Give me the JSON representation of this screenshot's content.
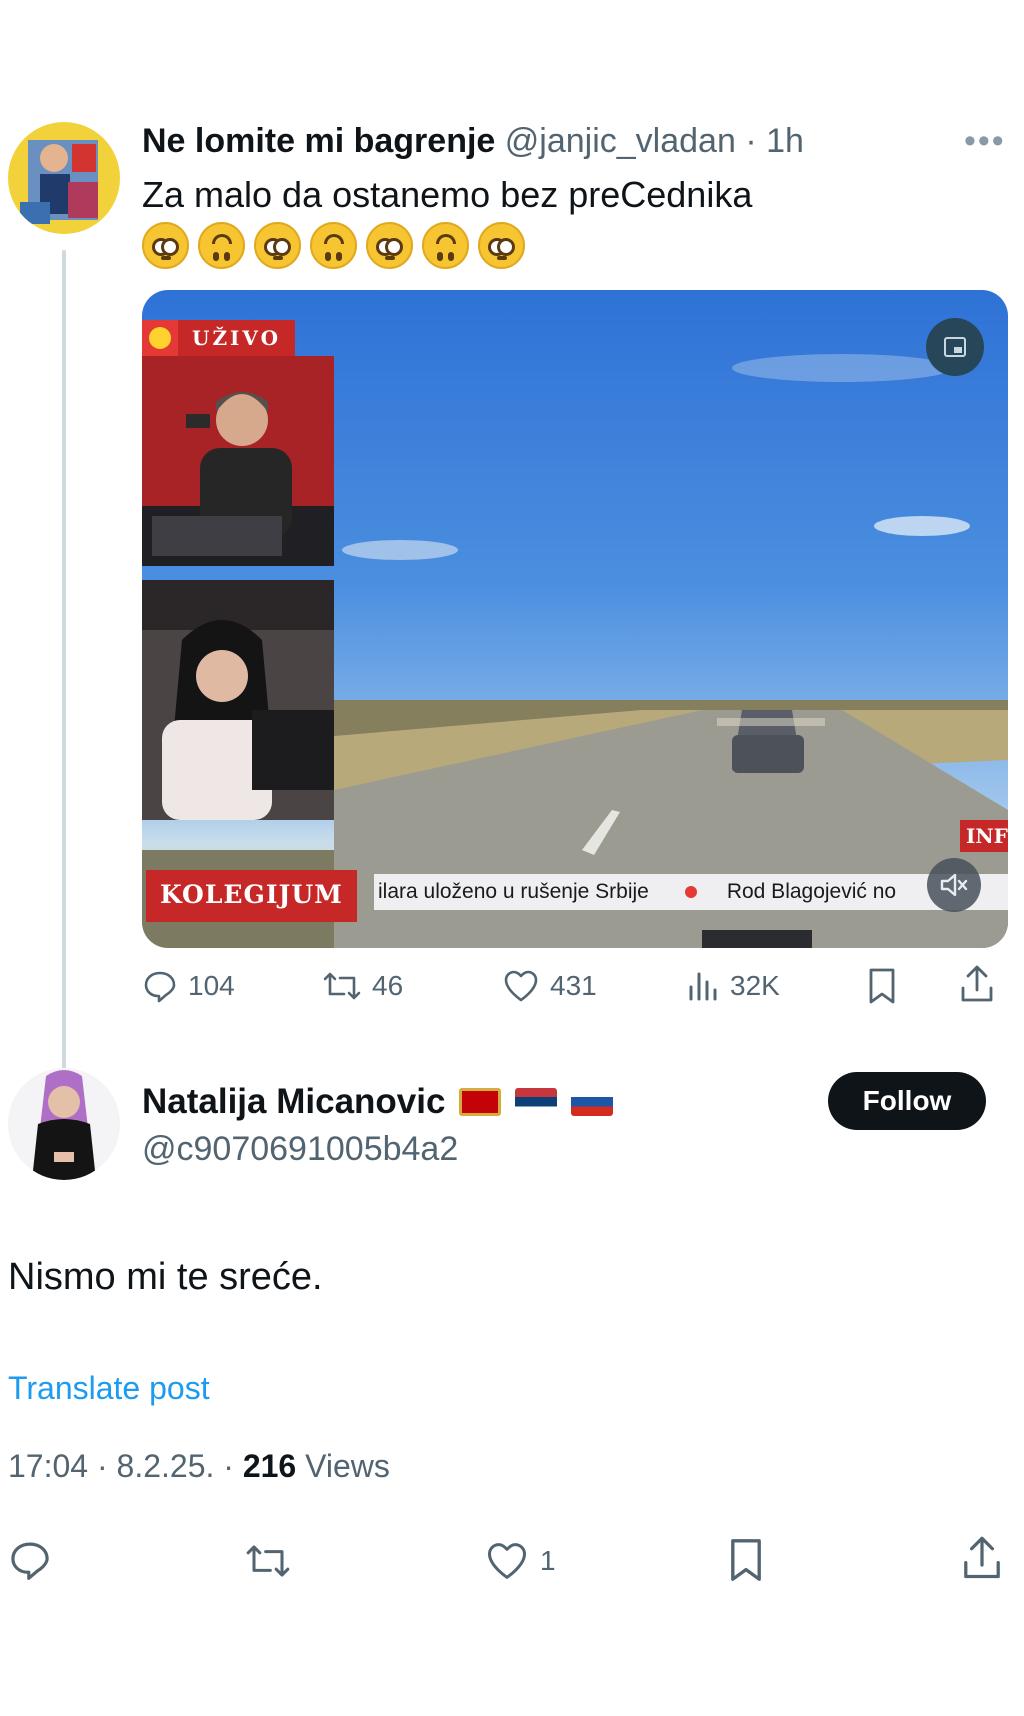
{
  "quoted_tweet": {
    "author_name": "Ne lomite mi bagrenje",
    "author_handle": "@janjic_vladan",
    "time_ago": "· 1h",
    "text": "Za malo da ostanemo bez preCednika",
    "emojis": [
      "flushed-face",
      "upside-down-face",
      "flushed-face",
      "upside-down-face",
      "flushed-face",
      "upside-down-face",
      "flushed-face"
    ],
    "video": {
      "live_label": "UŽIVO",
      "show_label": "KOLEGIJUM",
      "ticker_left": "ilara uloženo u rušenje Srbije",
      "ticker_right": "Rod Blagojević no",
      "channel_badge": "INF"
    },
    "stats": {
      "replies": "104",
      "reposts": "46",
      "likes": "431",
      "views": "32K"
    }
  },
  "reply_tweet": {
    "author_name": "Natalija Micanovic",
    "author_flags": [
      "montenegro-flag",
      "serbia-flag",
      "russia-flag"
    ],
    "author_handle": "@c9070691005b4a2",
    "follow_label": "Follow",
    "text": "Nismo mi te sreće.",
    "translate_label": "Translate post",
    "timestamp": "17:04 · 8.2.25. · ",
    "views_count": "216",
    "views_label": " Views",
    "likes": "1"
  },
  "colors": {
    "accent": "#1d9bf0",
    "text": "#0f1419",
    "secondary": "#536471",
    "follow_bg": "#0f1419",
    "live_red": "#c62828"
  }
}
